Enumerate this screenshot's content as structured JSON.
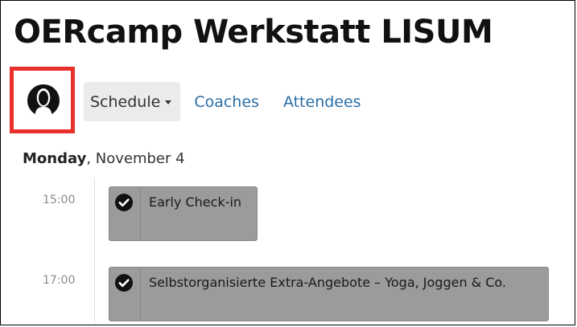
{
  "page": {
    "title": "OERcamp Werkstatt LISUM"
  },
  "avatar": {
    "icon": "user-silhouette-icon",
    "highlight_color": "#e8302d"
  },
  "nav": {
    "schedule_label": "Schedule",
    "coaches_label": "Coaches",
    "attendees_label": "Attendees",
    "link_color": "#2a6ea8"
  },
  "schedule": {
    "day_name": "Monday",
    "day_date": ", November 4",
    "events": [
      {
        "time": "15:00",
        "title": "Early Check-in",
        "status_icon": "check-circle-icon"
      },
      {
        "time": "17:00",
        "title": "Selbstorganisierte Extra-Angebote – Yoga, Joggen & Co.",
        "status_icon": "check-circle-icon"
      }
    ]
  }
}
